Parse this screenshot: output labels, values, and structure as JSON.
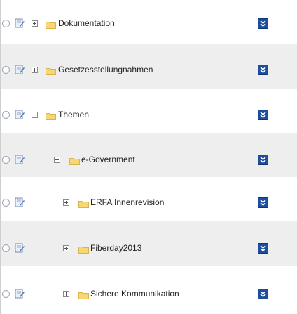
{
  "tree": {
    "items": [
      {
        "label": "Dokumentation",
        "expander": "plus",
        "level": 0
      },
      {
        "label": "Gesetzesstellungnahmen",
        "expander": "plus",
        "level": 0
      },
      {
        "label": "Themen",
        "expander": "minus",
        "level": 0
      },
      {
        "label": "e-Government",
        "expander": "minus",
        "level": 1
      },
      {
        "label": "ERFA Innenrevision",
        "expander": "plus",
        "level": 2
      },
      {
        "label": "Fiberday2013",
        "expander": "plus",
        "level": 2
      },
      {
        "label": "Sichere Kommunikation",
        "expander": "plus",
        "level": 2
      }
    ]
  },
  "icons": {
    "select": "radio-circle-icon",
    "edit": "edit-page-icon",
    "folder": "folder-icon",
    "menu": "double-chevron-down-icon"
  },
  "colors": {
    "menu_button": "#1d4e9b",
    "folder": "#f7d774",
    "alt_row": "#eeeeee"
  }
}
